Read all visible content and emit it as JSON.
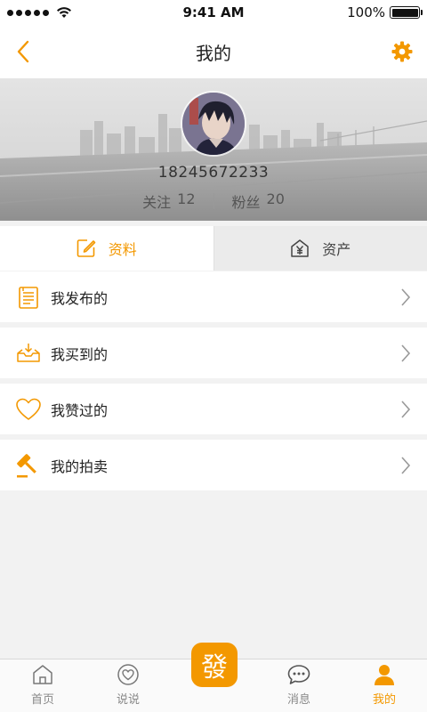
{
  "status_bar": {
    "time": "9:41 AM",
    "battery": "100%",
    "signal_dots": 5
  },
  "nav": {
    "title": "我的"
  },
  "profile": {
    "phone": "18245672233",
    "following_label": "关注",
    "following_count": "12",
    "followers_label": "粉丝",
    "followers_count": "20"
  },
  "tabs": [
    {
      "label": "资料",
      "active": true,
      "icon": "edit-icon"
    },
    {
      "label": "资产",
      "active": false,
      "icon": "house-yen-icon"
    }
  ],
  "menu": [
    {
      "label": "我发布的",
      "icon": "document-icon"
    },
    {
      "label": "我买到的",
      "icon": "inbox-download-icon"
    },
    {
      "label": "我赞过的",
      "icon": "heart-icon"
    },
    {
      "label": "我的拍卖",
      "icon": "auction-hammer-icon"
    }
  ],
  "tab_bar": {
    "items": [
      {
        "label": "首页",
        "icon": "home-icon",
        "active": false
      },
      {
        "label": "说说",
        "icon": "heart-circle-icon",
        "active": false
      },
      {
        "label": "消息",
        "icon": "chat-bubble-icon",
        "active": false
      },
      {
        "label": "我的",
        "icon": "person-icon",
        "active": true
      }
    ],
    "publish_label": "發"
  },
  "colors": {
    "accent": "#f39800",
    "background": "#f2f2f2",
    "tab_inactive_bg": "#ebebeb"
  }
}
